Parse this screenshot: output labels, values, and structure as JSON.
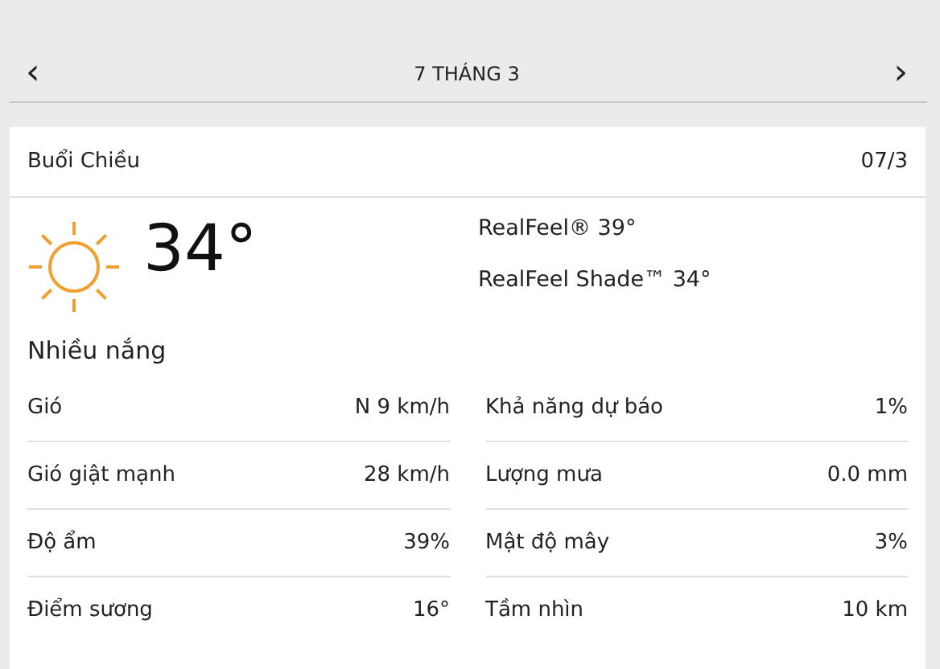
{
  "nav": {
    "prev": "‹",
    "title": "7 THÁNG 3",
    "next": "›"
  },
  "card": {
    "period": "Buổi Chiều",
    "date": "07/3",
    "temperature": "34°",
    "realfeel": [
      "RealFeel® 39°",
      "RealFeel Shade™ 34°"
    ],
    "phrase": "Nhiều nắng",
    "details": [
      {
        "label": "Gió",
        "value": "N 9 km/h"
      },
      {
        "label": "Khả năng dự báo",
        "value": "1%"
      },
      {
        "label": "Gió giật mạnh",
        "value": "28 km/h"
      },
      {
        "label": "Lượng mưa",
        "value": "0.0 mm"
      },
      {
        "label": "Độ ẩm",
        "value": "39%"
      },
      {
        "label": "Mật độ mây",
        "value": "3%"
      },
      {
        "label": "Điểm sương",
        "value": "16°"
      },
      {
        "label": "Tầm nhìn",
        "value": "10 km"
      }
    ]
  }
}
